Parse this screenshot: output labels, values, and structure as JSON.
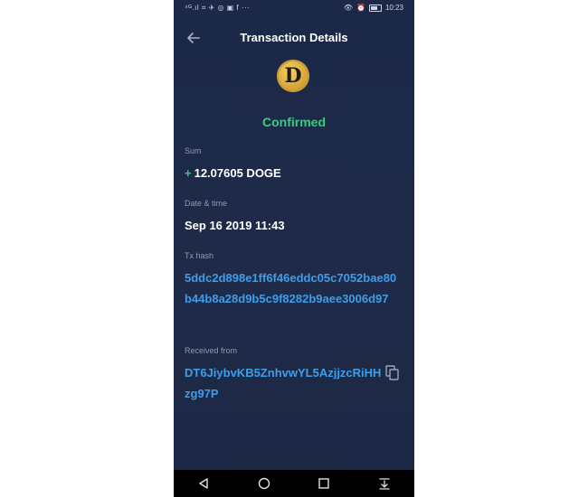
{
  "status_bar": {
    "left_icons": "⁴ᴳ.ıl ⌗ ✈ ◎ ▣ f ···",
    "time": "10:23"
  },
  "header": {
    "title": "Transaction Details"
  },
  "coin": {
    "symbol_letter": "D",
    "color": "#d8a93a"
  },
  "transaction": {
    "status": "Confirmed",
    "sum_label": "Sum",
    "sum_sign": "+",
    "sum_value": "12.07605 DOGE",
    "date_label": "Date & time",
    "date_value": "Sep 16 2019 11:43",
    "hash_label": "Tx hash",
    "hash_value": "5ddc2d898e1ff6f46eddc05c7052bae80b44b8a28d9b5c9f8282b9aee3006d97",
    "from_label": "Received from",
    "from_value": "DT6JiybvKB5ZnhvwYL5AzjjzcRiHHzg97P"
  },
  "colors": {
    "background": "#1d2846",
    "accent_green": "#34d07d",
    "link_blue": "#3e9ee8"
  }
}
